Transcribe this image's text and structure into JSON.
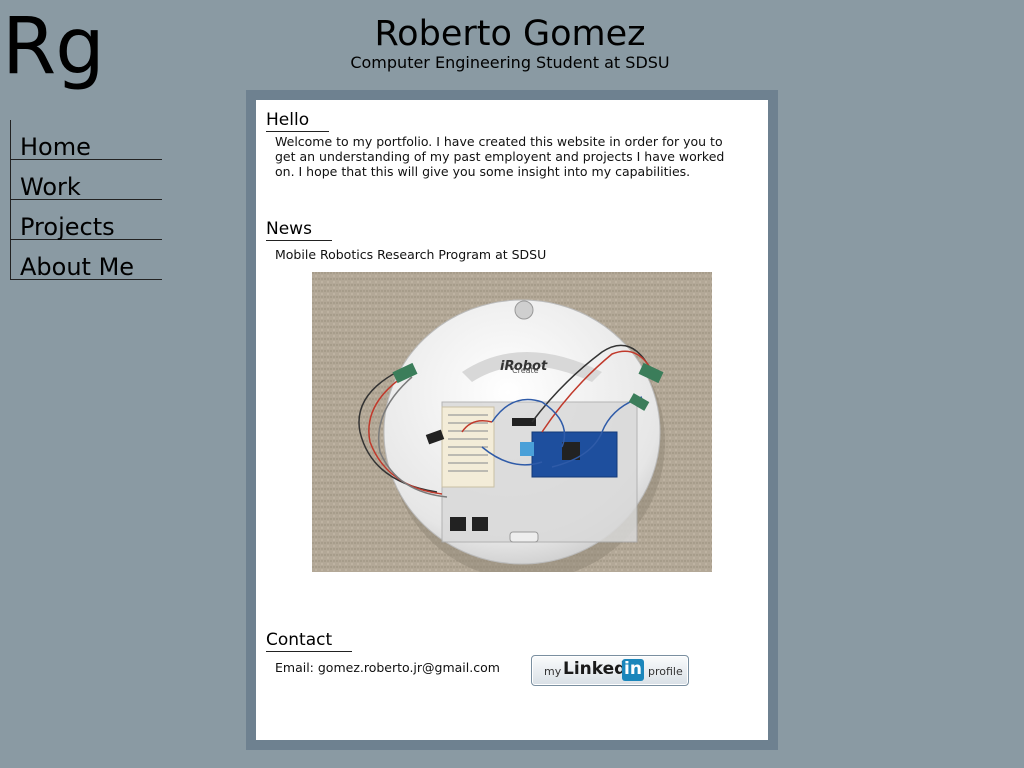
{
  "header": {
    "logo": "Rg",
    "title": "Roberto Gomez",
    "subtitle": "Computer Engineering Student at SDSU"
  },
  "nav": {
    "items": [
      {
        "label": "Home"
      },
      {
        "label": "Work"
      },
      {
        "label": "Projects"
      },
      {
        "label": "About Me"
      }
    ]
  },
  "hello": {
    "heading": "Hello",
    "lines": [
      "Welcome to my portfolio. I have created this website in order for you to",
      "get an understanding of my past employent and projects I have worked",
      "on. I hope that this will give you some insight into my capabilities."
    ]
  },
  "news": {
    "heading": "News",
    "text": "Mobile Robotics Research Program at SDSU",
    "image": {
      "brand_label": "iRobot",
      "model_label": "Create"
    }
  },
  "contact": {
    "heading": "Contact",
    "email": "Email: gomez.roberto.jr@gmail.com",
    "linkedin": {
      "my": "my",
      "linked": "Linked",
      "in": "in",
      "profile": "profile"
    }
  },
  "colors": {
    "page_background": "#8a9aa3",
    "frame": "#6e8190",
    "content_background": "#ffffff",
    "linkedin_blue": "#1b86bb"
  }
}
